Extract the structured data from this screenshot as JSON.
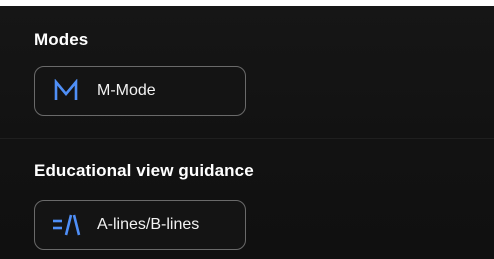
{
  "colors": {
    "background": "#141414",
    "button_border": "#6a6a6a",
    "accent": "#4f8ff7",
    "text": "#ffffff"
  },
  "modes": {
    "title": "Modes",
    "buttons": [
      {
        "label": "M-Mode",
        "icon": "m-mode-icon"
      }
    ]
  },
  "guidance": {
    "title": "Educational view guidance",
    "buttons": [
      {
        "label": "A-lines/B-lines",
        "icon": "a-lines-b-lines-icon"
      }
    ]
  }
}
